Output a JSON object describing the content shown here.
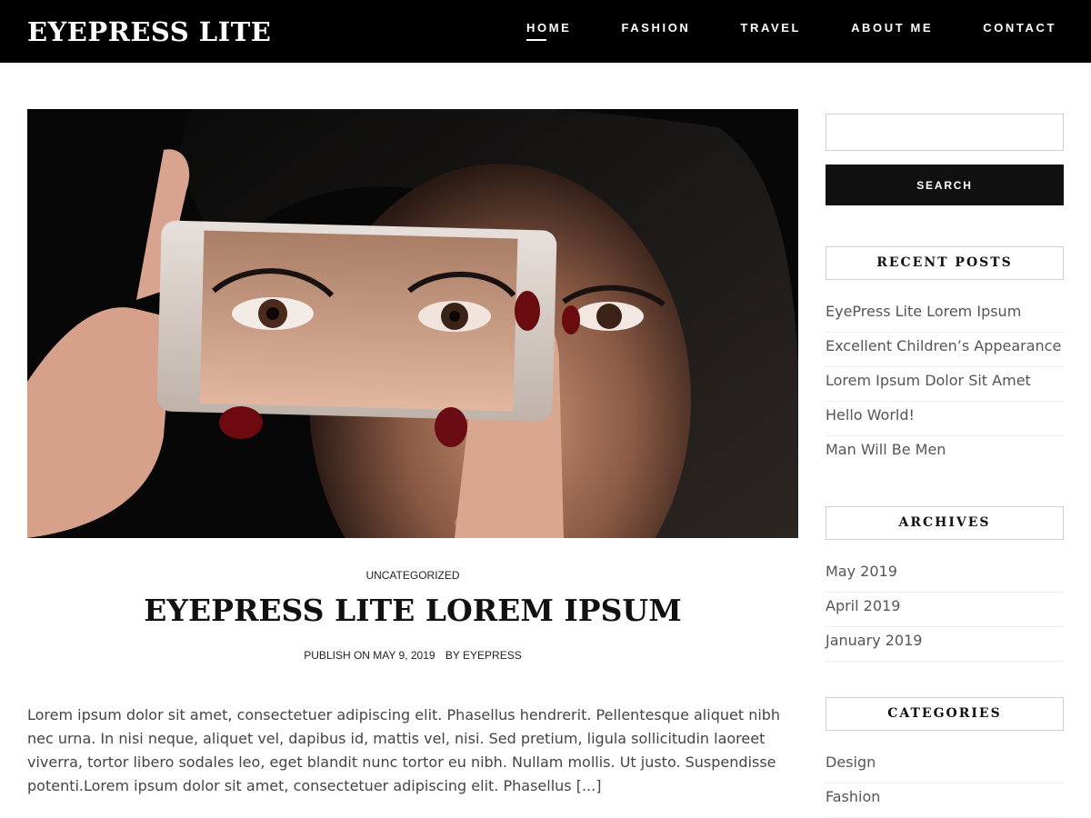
{
  "site": {
    "logo": "EYEPRESS LITE",
    "nav": [
      {
        "label": "HOME",
        "active": true
      },
      {
        "label": "FASHION"
      },
      {
        "label": "TRAVEL"
      },
      {
        "label": "ABOUT ME"
      },
      {
        "label": "CONTACT"
      }
    ]
  },
  "post": {
    "category": "UNCATEGORIZED",
    "title": "EYEPRESS LITE LOREM IPSUM",
    "meta_date": "PUBLISH ON MAY 9, 2019",
    "meta_author": "BY EYEPRESS",
    "excerpt": "Lorem ipsum dolor sit amet, consectetuer adipiscing elit. Phasellus hendrerit. Pellentesque aliquet nibh nec urna. In nisi neque, aliquet vel, dapibus id, mattis vel, nisi. Sed pretium, ligula sollicitudin laoreet viverra, tortor libero sodales leo, eget blandit nunc tortor eu nibh. Nullam mollis. Ut justo. Suspendisse potenti.Lorem ipsum dolor sit amet, consectetuer adipiscing elit. Phasellus [...]"
  },
  "sidebar": {
    "search_placeholder": "",
    "search_button": "SEARCH",
    "recent_posts": {
      "title": "RECENT POSTS",
      "items": [
        "EyePress Lite Lorem Ipsum",
        "Excellent Children’s Appearance",
        "Lorem Ipsum Dolor Sit Amet",
        "Hello World!",
        "Man Will Be Men"
      ]
    },
    "archives": {
      "title": "ARCHIVES",
      "items": [
        "May 2019",
        "April 2019",
        "January 2019"
      ]
    },
    "categories": {
      "title": "CATEGORIES",
      "items": [
        "Design",
        "Fashion"
      ]
    }
  },
  "colors": {
    "header_bg": "#000000",
    "button_bg": "#111111",
    "text": "#444444"
  }
}
